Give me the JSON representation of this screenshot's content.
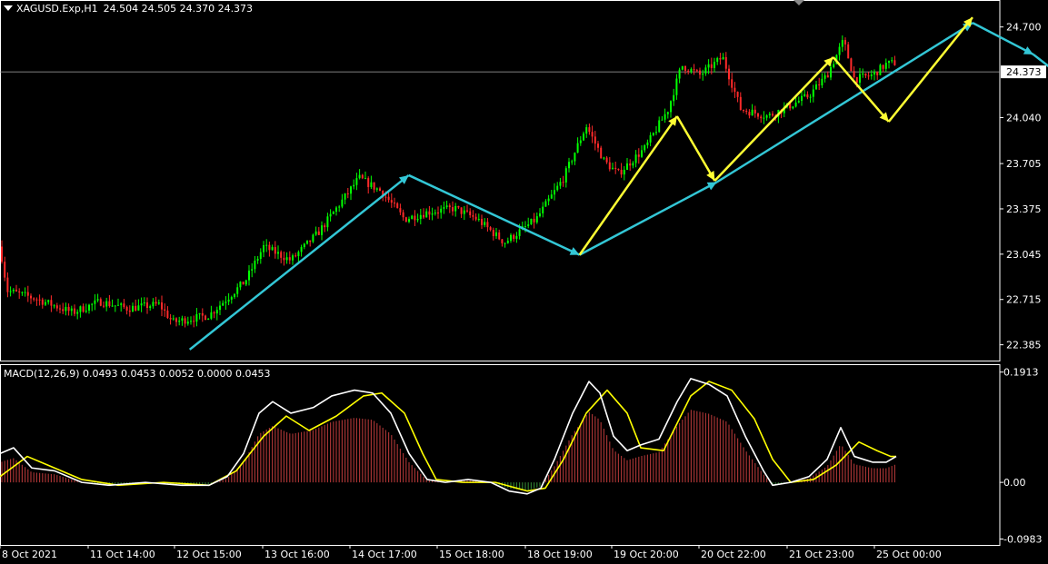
{
  "window": {
    "symbol": "XAGUSD.Exp,H1",
    "ohlc": "24.504 24.505 24.370 24.373"
  },
  "macd": {
    "title": "MACD(12,26,9) 0.0493 0.0453 0.0052 0.0000 0.0453"
  },
  "colors": {
    "background": "#000000",
    "bull_candle": "#00ff00",
    "bear_candle": "#ff2a2a",
    "cyan_wave": "#33c7d6",
    "yellow_wave": "#ffff33",
    "macd_line": "#ffffff",
    "signal_line": "#ffff00",
    "hist_positive": "#a33333",
    "hist_negative": "#2f7a2f",
    "grid_text": "#ffffff",
    "current_price_line": "#aaaaaa"
  },
  "chart_data": [
    {
      "type": "candlestick",
      "title": "XAGUSD.Exp,H1",
      "y_ticks": [
        "24.700",
        "24.040",
        "23.705",
        "23.375",
        "23.045",
        "22.715",
        "22.385"
      ],
      "ylim": [
        22.27,
        24.87
      ],
      "current_price": "24.373",
      "x_ticks": [
        "8 Oct 2021",
        "11 Oct 14:00",
        "12 Oct 15:00",
        "13 Oct 16:00",
        "14 Oct 17:00",
        "15 Oct 18:00",
        "18 Oct 19:00",
        "19 Oct 20:00",
        "20 Oct 22:00",
        "21 Oct 23:00",
        "25 Oct 00:00"
      ],
      "price_path": [
        [
          0,
          23.1
        ],
        [
          8,
          22.78
        ],
        [
          40,
          22.72
        ],
        [
          80,
          22.62
        ],
        [
          110,
          22.7
        ],
        [
          140,
          22.65
        ],
        [
          175,
          22.68
        ],
        [
          190,
          22.55
        ],
        [
          230,
          22.6
        ],
        [
          270,
          22.85
        ],
        [
          290,
          23.1
        ],
        [
          320,
          23.0
        ],
        [
          350,
          23.2
        ],
        [
          395,
          23.6
        ],
        [
          420,
          23.5
        ],
        [
          445,
          23.3
        ],
        [
          470,
          23.35
        ],
        [
          500,
          23.38
        ],
        [
          525,
          23.3
        ],
        [
          555,
          23.13
        ],
        [
          590,
          23.3
        ],
        [
          620,
          23.6
        ],
        [
          645,
          23.98
        ],
        [
          665,
          23.72
        ],
        [
          680,
          23.63
        ],
        [
          710,
          23.82
        ],
        [
          735,
          24.1
        ],
        [
          750,
          24.42
        ],
        [
          770,
          24.35
        ],
        [
          795,
          24.48
        ],
        [
          815,
          24.1
        ],
        [
          845,
          24.05
        ],
        [
          870,
          24.13
        ],
        [
          890,
          24.2
        ],
        [
          910,
          24.35
        ],
        [
          928,
          24.6
        ],
        [
          940,
          24.32
        ],
        [
          960,
          24.35
        ],
        [
          975,
          24.43
        ],
        [
          986,
          24.44
        ]
      ],
      "wave_cyan": [
        [
          22.35,
          0.181
        ],
        [
          23.62,
          0.39
        ],
        [
          23.04,
          0.553
        ],
        [
          23.57,
          0.684
        ],
        [
          24.73,
          0.928
        ],
        [
          24.5,
          0.986
        ],
        [
          24.06,
          1.06
        ],
        [
          24.91,
          1.142
        ]
      ],
      "wave_yellow": [
        [
          23.04,
          0.553
        ],
        [
          24.05,
          0.646
        ],
        [
          23.58,
          0.682
        ],
        [
          24.48,
          0.795
        ],
        [
          24.01,
          0.848
        ],
        [
          24.77,
          0.928
        ]
      ]
    },
    {
      "type": "line",
      "title": "MACD(12,26,9)",
      "y_ticks": [
        "0.1913",
        "0.00",
        "-0.0983"
      ],
      "ylim": [
        -0.1085,
        0.205
      ],
      "series": [
        {
          "name": "MACD",
          "points": [
            [
              0,
              0.05
            ],
            [
              15,
              0.06
            ],
            [
              35,
              0.025
            ],
            [
              60,
              0.02
            ],
            [
              90,
              0.0
            ],
            [
              120,
              -0.005
            ],
            [
              160,
              0.0
            ],
            [
              200,
              -0.005
            ],
            [
              230,
              -0.005
            ],
            [
              250,
              0.01
            ],
            [
              268,
              0.05
            ],
            [
              285,
              0.12
            ],
            [
              300,
              0.14
            ],
            [
              320,
              0.12
            ],
            [
              345,
              0.13
            ],
            [
              365,
              0.15
            ],
            [
              390,
              0.16
            ],
            [
              410,
              0.155
            ],
            [
              430,
              0.12
            ],
            [
              450,
              0.05
            ],
            [
              470,
              0.005
            ],
            [
              490,
              0.0
            ],
            [
              515,
              0.005
            ],
            [
              540,
              0.0
            ],
            [
              560,
              -0.015
            ],
            [
              580,
              -0.02
            ],
            [
              595,
              -0.01
            ],
            [
              610,
              0.04
            ],
            [
              630,
              0.12
            ],
            [
              648,
              0.175
            ],
            [
              660,
              0.155
            ],
            [
              675,
              0.08
            ],
            [
              690,
              0.055
            ],
            [
              705,
              0.065
            ],
            [
              725,
              0.075
            ],
            [
              745,
              0.14
            ],
            [
              760,
              0.18
            ],
            [
              780,
              0.17
            ],
            [
              800,
              0.15
            ],
            [
              820,
              0.08
            ],
            [
              840,
              0.02
            ],
            [
              850,
              -0.005
            ],
            [
              870,
              0.0
            ],
            [
              890,
              0.01
            ],
            [
              910,
              0.04
            ],
            [
              925,
              0.095
            ],
            [
              940,
              0.045
            ],
            [
              960,
              0.035
            ],
            [
              975,
              0.035
            ],
            [
              986,
              0.045
            ]
          ]
        },
        {
          "name": "Signal",
          "points": [
            [
              0,
              0.01
            ],
            [
              30,
              0.045
            ],
            [
              60,
              0.025
            ],
            [
              90,
              0.005
            ],
            [
              130,
              -0.005
            ],
            [
              180,
              0.0
            ],
            [
              230,
              -0.005
            ],
            [
              260,
              0.02
            ],
            [
              290,
              0.08
            ],
            [
              315,
              0.115
            ],
            [
              340,
              0.09
            ],
            [
              370,
              0.115
            ],
            [
              400,
              0.15
            ],
            [
              420,
              0.155
            ],
            [
              445,
              0.12
            ],
            [
              465,
              0.05
            ],
            [
              480,
              0.005
            ],
            [
              510,
              0.0
            ],
            [
              545,
              0.0
            ],
            [
              580,
              -0.015
            ],
            [
              600,
              -0.01
            ],
            [
              620,
              0.04
            ],
            [
              645,
              0.12
            ],
            [
              668,
              0.16
            ],
            [
              690,
              0.12
            ],
            [
              705,
              0.06
            ],
            [
              730,
              0.055
            ],
            [
              760,
              0.15
            ],
            [
              780,
              0.175
            ],
            [
              805,
              0.16
            ],
            [
              830,
              0.11
            ],
            [
              850,
              0.04
            ],
            [
              870,
              0.0
            ],
            [
              895,
              0.005
            ],
            [
              920,
              0.03
            ],
            [
              945,
              0.07
            ],
            [
              965,
              0.055
            ],
            [
              980,
              0.045
            ],
            [
              986,
              0.045
            ]
          ]
        }
      ]
    }
  ]
}
